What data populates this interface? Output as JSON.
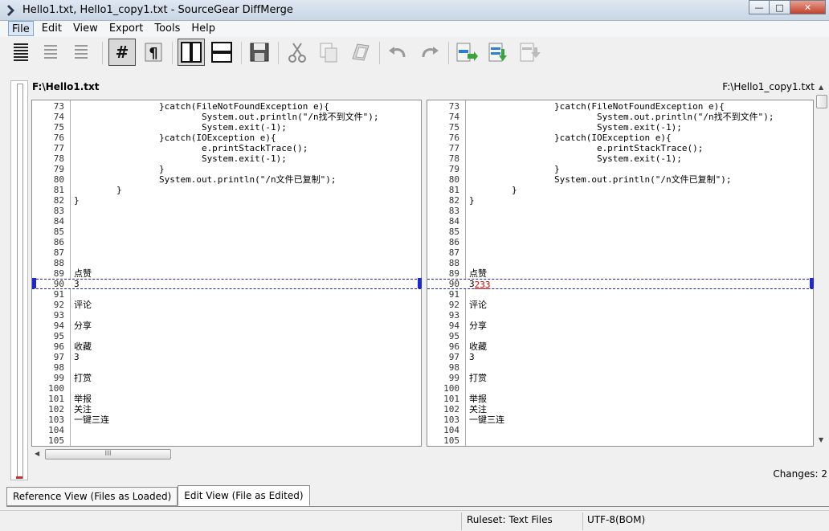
{
  "window": {
    "title": "Hello1.txt, Hello1_copy1.txt - SourceGear DiffMerge",
    "controls": {
      "minimize": "—",
      "maximize": "□",
      "close": "✕"
    }
  },
  "menu": [
    "File",
    "Edit",
    "View",
    "Export",
    "Tools",
    "Help"
  ],
  "toolbar": [
    "show-all-lines-icon",
    "show-differences-icon",
    "show-context-icon",
    "line-numbers-icon",
    "pilcrow-icon",
    "side-by-side-icon",
    "top-bottom-icon",
    "save-icon",
    "cut-icon",
    "copy-icon",
    "paste-icon",
    "undo-icon",
    "redo-icon",
    "apply-change-icon",
    "apply-all-icon",
    "export-icon"
  ],
  "left_pane": {
    "path": "F:\\Hello1.txt",
    "lines": [
      {
        "n": "73",
        "t": "                }catch(FileNotFoundException e){"
      },
      {
        "n": "74",
        "t": "                        System.out.println(\"/n找不到文件\");"
      },
      {
        "n": "75",
        "t": "                        System.exit(-1);"
      },
      {
        "n": "76",
        "t": "                }catch(IOException e){"
      },
      {
        "n": "77",
        "t": "                        e.printStackTrace();"
      },
      {
        "n": "78",
        "t": "                        System.exit(-1);"
      },
      {
        "n": "79",
        "t": "                }"
      },
      {
        "n": "80",
        "t": "                System.out.println(\"/n文件已复制\");"
      },
      {
        "n": "81",
        "t": "        }"
      },
      {
        "n": "82",
        "t": "}"
      },
      {
        "n": "83",
        "t": ""
      },
      {
        "n": "84",
        "t": ""
      },
      {
        "n": "85",
        "t": ""
      },
      {
        "n": "86",
        "t": ""
      },
      {
        "n": "87",
        "t": ""
      },
      {
        "n": "88",
        "t": ""
      },
      {
        "n": "89",
        "t": "点赞"
      },
      {
        "n": "90",
        "t": "3",
        "diff": true
      },
      {
        "n": "91",
        "t": ""
      },
      {
        "n": "92",
        "t": "评论"
      },
      {
        "n": "93",
        "t": ""
      },
      {
        "n": "94",
        "t": "分享"
      },
      {
        "n": "95",
        "t": ""
      },
      {
        "n": "96",
        "t": "收藏"
      },
      {
        "n": "97",
        "t": "3"
      },
      {
        "n": "98",
        "t": ""
      },
      {
        "n": "99",
        "t": "打赏"
      },
      {
        "n": "100",
        "t": ""
      },
      {
        "n": "101",
        "t": "举报"
      },
      {
        "n": "102",
        "t": "关注"
      },
      {
        "n": "103",
        "t": "一键三连"
      },
      {
        "n": "104",
        "t": ""
      },
      {
        "n": "105",
        "t": ""
      }
    ]
  },
  "right_pane": {
    "path": "F:\\Hello1_copy1.txt",
    "lines": [
      {
        "n": "73",
        "t": "                }catch(FileNotFoundException e){"
      },
      {
        "n": "74",
        "t": "                        System.out.println(\"/n找不到文件\");"
      },
      {
        "n": "75",
        "t": "                        System.exit(-1);"
      },
      {
        "n": "76",
        "t": "                }catch(IOException e){"
      },
      {
        "n": "77",
        "t": "                        e.printStackTrace();"
      },
      {
        "n": "78",
        "t": "                        System.exit(-1);"
      },
      {
        "n": "79",
        "t": "                }"
      },
      {
        "n": "80",
        "t": "                System.out.println(\"/n文件已复制\");"
      },
      {
        "n": "81",
        "t": "        }"
      },
      {
        "n": "82",
        "t": "}"
      },
      {
        "n": "83",
        "t": ""
      },
      {
        "n": "84",
        "t": ""
      },
      {
        "n": "85",
        "t": ""
      },
      {
        "n": "86",
        "t": ""
      },
      {
        "n": "87",
        "t": ""
      },
      {
        "n": "88",
        "t": ""
      },
      {
        "n": "89",
        "t": "点赞"
      },
      {
        "n": "90",
        "t": "3",
        "changed": "233",
        "diff": true
      },
      {
        "n": "91",
        "t": ""
      },
      {
        "n": "92",
        "t": "评论"
      },
      {
        "n": "93",
        "t": ""
      },
      {
        "n": "94",
        "t": "分享"
      },
      {
        "n": "95",
        "t": ""
      },
      {
        "n": "96",
        "t": "收藏"
      },
      {
        "n": "97",
        "t": "3"
      },
      {
        "n": "98",
        "t": ""
      },
      {
        "n": "99",
        "t": "打赏"
      },
      {
        "n": "100",
        "t": ""
      },
      {
        "n": "101",
        "t": "举报"
      },
      {
        "n": "102",
        "t": "关注"
      },
      {
        "n": "103",
        "t": "一键三连"
      },
      {
        "n": "104",
        "t": ""
      },
      {
        "n": "105",
        "t": ""
      }
    ]
  },
  "scrollbar": {
    "h_thumb_grip": "III"
  },
  "changes": "Changes: 2",
  "tabs": [
    "Reference View (Files as Loaded)",
    "Edit View (File as Edited)"
  ],
  "status": {
    "ruleset": "Ruleset: Text Files",
    "encoding": "UTF-8(BOM)"
  },
  "colors": {
    "diff_marker": "#1a2ad0",
    "changed_text": "#d40000",
    "overview_mark": "#c83232"
  }
}
